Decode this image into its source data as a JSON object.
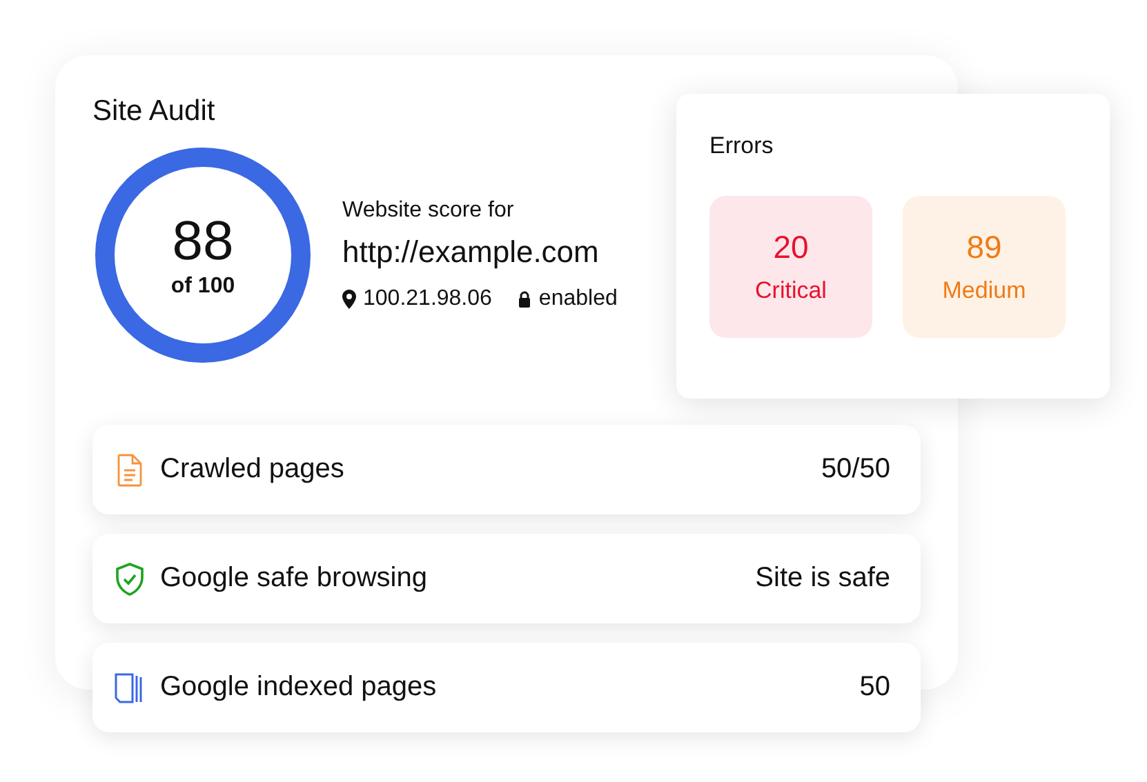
{
  "title": "Site Audit",
  "score": {
    "value": "88",
    "suffix": "of 100"
  },
  "site": {
    "caption": "Website score for",
    "url": "http://example.com",
    "ip": "100.21.98.06",
    "ssl": "enabled"
  },
  "errors": {
    "title": "Errors",
    "items": [
      {
        "count": "20",
        "label": "Critical",
        "color": "#e8112d"
      },
      {
        "count": "89",
        "label": "Medium",
        "color": "#f07b13"
      }
    ]
  },
  "stats": [
    {
      "kind": "document",
      "label": "Crawled pages",
      "value": "50/50"
    },
    {
      "kind": "shield",
      "label": "Google safe browsing",
      "value": "Site is safe"
    },
    {
      "kind": "pages",
      "label": "Google indexed pages",
      "value": "50"
    }
  ]
}
